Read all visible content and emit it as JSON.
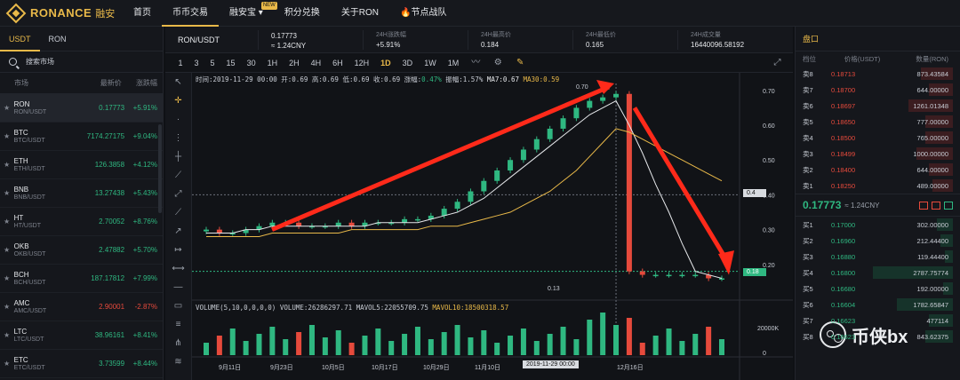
{
  "brand": {
    "name": "RONANCE",
    "cn": "融安"
  },
  "nav": [
    {
      "label": "首页"
    },
    {
      "label": "币币交易",
      "active": true
    },
    {
      "label": "融安宝",
      "badge": "NEW",
      "dropdown": true
    },
    {
      "label": "积分兑换"
    },
    {
      "label": "关于RON"
    },
    {
      "label": "节点战队",
      "icon": "flame-icon"
    }
  ],
  "left": {
    "tabs": [
      "USDT",
      "RON"
    ],
    "search_placeholder": "搜索市场",
    "headers": {
      "market": "市场",
      "price": "最新价",
      "change": "涨跌幅"
    },
    "markets": [
      {
        "name": "RON",
        "pair": "RON/USDT",
        "price": "0.17773",
        "change": "+5.91%",
        "dir": "up",
        "selected": true
      },
      {
        "name": "BTC",
        "pair": "BTC/USDT",
        "price": "7174.27175",
        "change": "+9.04%",
        "dir": "up"
      },
      {
        "name": "ETH",
        "pair": "ETH/USDT",
        "price": "126.3858",
        "change": "+4.12%",
        "dir": "up"
      },
      {
        "name": "BNB",
        "pair": "BNB/USDT",
        "price": "13.27438",
        "change": "+5.43%",
        "dir": "up"
      },
      {
        "name": "HT",
        "pair": "HT/USDT",
        "price": "2.70052",
        "change": "+8.76%",
        "dir": "up"
      },
      {
        "name": "OKB",
        "pair": "OKB/USDT",
        "price": "2.47882",
        "change": "+5.70%",
        "dir": "up"
      },
      {
        "name": "BCH",
        "pair": "BCH/USDT",
        "price": "187.17812",
        "change": "+7.99%",
        "dir": "up"
      },
      {
        "name": "AMC",
        "pair": "AMC/USDT",
        "price": "2.90001",
        "change": "-2.87%",
        "dir": "down"
      },
      {
        "name": "LTC",
        "pair": "LTC/USDT",
        "price": "38.96161",
        "change": "+8.41%",
        "dir": "up"
      },
      {
        "name": "ETC",
        "pair": "ETC/USDT",
        "price": "3.73599",
        "change": "+8.44%",
        "dir": "up"
      }
    ]
  },
  "ticker": {
    "pair": "RON/USDT",
    "last": "0.17773",
    "last_cny": "≈ 1.24CNY",
    "change_label": "24H涨跌幅",
    "change": "+5.91%",
    "high_label": "24H最高价",
    "high": "0.184",
    "low_label": "24H最低价",
    "low": "0.165",
    "vol_label": "24H成交量",
    "vol": "16440096.58192"
  },
  "intervals": [
    "1",
    "3",
    "5",
    "15",
    "30",
    "1H",
    "2H",
    "4H",
    "6H",
    "12H",
    "1D",
    "3D",
    "1W",
    "1M"
  ],
  "active_interval": "1D",
  "toolbar_icons": [
    "chart-type-icon",
    "settings-icon",
    "pencil-icon"
  ],
  "legend": {
    "text": "时间:2019-11-29 00:00  开:0.69  高:0.69  低:0.69  收:0.69  涨幅:",
    "change": "0.47%",
    "rest": "  振幅:1.57%  ",
    "ma7": "MA7:0.67",
    "ma30": "MA30:0.59"
  },
  "vol_legend": {
    "main": "VOLUME(5,10,0,0,0,0)  VOLUME:26286297.71  MAVOL5:22055709.75  ",
    "mavol10": "MAVOL10:18500318.57"
  },
  "y_ticks": [
    "0.70",
    "0.60",
    "0.50",
    "0.40",
    "0.30",
    "0.20"
  ],
  "vol_ticks": [
    "20000K",
    "0"
  ],
  "x_ticks": [
    "9月11日",
    "9月23日",
    "10月5日",
    "10月17日",
    "10月29日",
    "11月10日",
    "12月16日"
  ],
  "hair_x_label": "2019-11-29 00:00",
  "hair_y_label": "0.4",
  "current_price_label": "0.18",
  "high_annot": "0.70",
  "low_annot": "0.13",
  "chart_data": {
    "type": "candlestick",
    "title": "RON/USDT 1D",
    "x_range": [
      "2019-09-01",
      "2019-12-20"
    ],
    "ylim": [
      0.1,
      0.72
    ],
    "series": [
      {
        "name": "close",
        "values": [
          0.3,
          0.29,
          0.29,
          0.3,
          0.31,
          0.32,
          0.32,
          0.31,
          0.31,
          0.31,
          0.32,
          0.31,
          0.32,
          0.32,
          0.32,
          0.33,
          0.33,
          0.34,
          0.36,
          0.38,
          0.41,
          0.44,
          0.47,
          0.5,
          0.53,
          0.56,
          0.59,
          0.62,
          0.65,
          0.67,
          0.68,
          0.69,
          0.18,
          0.17,
          0.17,
          0.17,
          0.17,
          0.17,
          0.16,
          0.16
        ]
      },
      {
        "name": "MA7",
        "values": [
          0.29,
          0.29,
          0.29,
          0.3,
          0.3,
          0.31,
          0.31,
          0.31,
          0.31,
          0.31,
          0.31,
          0.31,
          0.31,
          0.32,
          0.32,
          0.32,
          0.32,
          0.33,
          0.34,
          0.35,
          0.37,
          0.39,
          0.42,
          0.45,
          0.48,
          0.51,
          0.54,
          0.57,
          0.6,
          0.63,
          0.65,
          0.67,
          0.6,
          0.52,
          0.43,
          0.35,
          0.26,
          0.18,
          0.17,
          0.16
        ]
      },
      {
        "name": "MA30",
        "values": [
          0.28,
          0.28,
          0.28,
          0.28,
          0.28,
          0.29,
          0.29,
          0.29,
          0.29,
          0.29,
          0.29,
          0.3,
          0.3,
          0.3,
          0.3,
          0.3,
          0.3,
          0.31,
          0.31,
          0.31,
          0.32,
          0.33,
          0.34,
          0.35,
          0.37,
          0.39,
          0.41,
          0.44,
          0.47,
          0.51,
          0.55,
          0.59,
          0.58,
          0.56,
          0.54,
          0.52,
          0.5,
          0.48,
          0.46,
          0.44
        ]
      }
    ],
    "high": 0.7,
    "low": 0.13,
    "volume_unit": "K",
    "volume_max": 20000
  },
  "orderbook": {
    "title": "盘口",
    "headers": {
      "level": "档位",
      "price": "价格(USDT)",
      "qty": "数量(RON)"
    },
    "asks": [
      {
        "level": "卖8",
        "price": "0.18713",
        "qty": "873.43584",
        "depth": 0.4
      },
      {
        "level": "卖7",
        "price": "0.18700",
        "qty": "644.00000",
        "depth": 0.3
      },
      {
        "level": "卖6",
        "price": "0.18697",
        "qty": "1261.01348",
        "depth": 0.55
      },
      {
        "level": "卖5",
        "price": "0.18650",
        "qty": "777.00000",
        "depth": 0.35
      },
      {
        "level": "卖4",
        "price": "0.18500",
        "qty": "765.00000",
        "depth": 0.35
      },
      {
        "level": "卖3",
        "price": "0.18499",
        "qty": "1000.00000",
        "depth": 0.45
      },
      {
        "level": "卖2",
        "price": "0.18400",
        "qty": "644.00000",
        "depth": 0.3
      },
      {
        "level": "卖1",
        "price": "0.18250",
        "qty": "489.00000",
        "depth": 0.25
      }
    ],
    "last": "0.17773",
    "last_cny": "≈ 1.24CNY",
    "bids": [
      {
        "level": "买1",
        "price": "0.17000",
        "qty": "302.00000",
        "depth": 0.2
      },
      {
        "level": "买2",
        "price": "0.16960",
        "qty": "212.44400",
        "depth": 0.15
      },
      {
        "level": "买3",
        "price": "0.16880",
        "qty": "119.44400",
        "depth": 0.1
      },
      {
        "level": "买4",
        "price": "0.16800",
        "qty": "2787.75774",
        "depth": 1.0
      },
      {
        "level": "买5",
        "price": "0.16680",
        "qty": "192.00000",
        "depth": 0.12
      },
      {
        "level": "买6",
        "price": "0.16604",
        "qty": "1782.65847",
        "depth": 0.7
      },
      {
        "level": "买7",
        "price": "0.16623",
        "qty": "477114",
        "depth": 0.3
      },
      {
        "level": "买8",
        "price": "0.16623",
        "qty": "843.62375",
        "depth": 0.35
      }
    ]
  },
  "watermark": "币侠bx",
  "colors": {
    "accent": "#e9b949",
    "up": "#2fb881",
    "down": "#e64a3c",
    "arrow": "#ff2a1a"
  }
}
